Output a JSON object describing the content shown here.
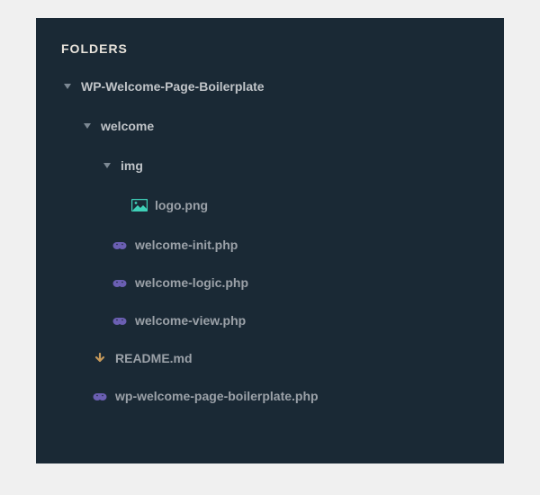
{
  "panel": {
    "title": "FOLDERS"
  },
  "tree": {
    "root": {
      "name": "WP-Welcome-Page-Boilerplate",
      "children": {
        "welcome": {
          "name": "welcome",
          "children": {
            "img": {
              "name": "img",
              "files": {
                "logo": "logo.png"
              }
            }
          },
          "files": {
            "init": "welcome-init.php",
            "logic": "welcome-logic.php",
            "view": "welcome-view.php"
          }
        }
      },
      "files": {
        "readme": "README.md",
        "plugin": "wp-welcome-page-boilerplate.php"
      }
    }
  },
  "colors": {
    "bg": "#1a2935",
    "folder": "#c0c4c8",
    "file": "#9ba1a8",
    "arrow": "#7c8893",
    "imageIcon": "#3fd0b8",
    "phpIcon": "#6b5fb3",
    "mdIcon": "#c4985a"
  }
}
